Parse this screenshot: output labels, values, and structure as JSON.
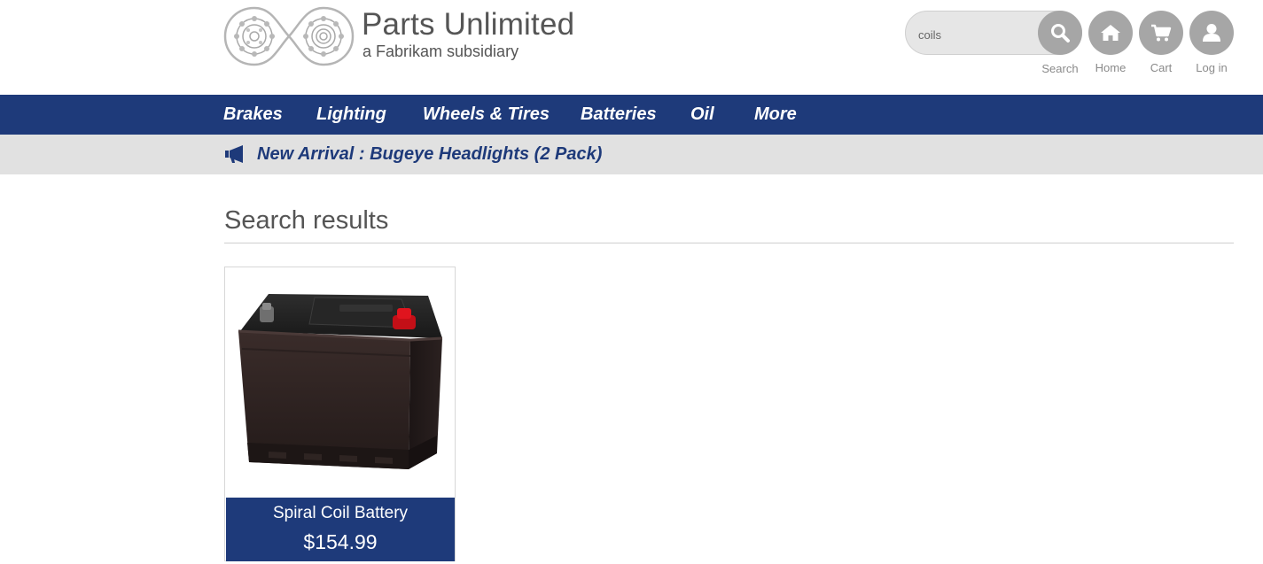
{
  "brand": {
    "title": "Parts Unlimited",
    "subtitle": "a Fabrikam subsidiary"
  },
  "header": {
    "search": {
      "value": "coils",
      "label": "Search",
      "icon": "search-icon"
    },
    "home": {
      "label": "Home",
      "icon": "home-icon"
    },
    "cart": {
      "label": "Cart",
      "icon": "cart-icon"
    },
    "login": {
      "label": "Log in",
      "icon": "user-icon"
    }
  },
  "nav": {
    "items": [
      {
        "label": "Brakes"
      },
      {
        "label": "Lighting"
      },
      {
        "label": "Wheels & Tires"
      },
      {
        "label": "Batteries"
      },
      {
        "label": "Oil"
      },
      {
        "label": "More"
      }
    ]
  },
  "announcement": {
    "icon": "megaphone-icon",
    "text": "New Arrival : Bugeye Headlights (2 Pack)"
  },
  "main": {
    "title": "Search results",
    "products": [
      {
        "name": "Spiral Coil Battery",
        "price": "$154.99",
        "image": "car-battery"
      }
    ]
  },
  "colors": {
    "nav_bg": "#1e3a7a",
    "announce_bg": "#e1e1e1",
    "icon_button": "#a6a6a6",
    "battery_terminal": "#e0141e"
  }
}
